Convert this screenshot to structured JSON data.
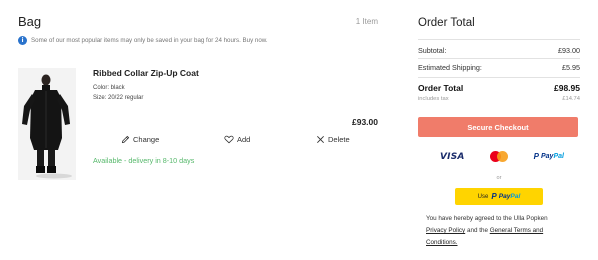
{
  "bag": {
    "title": "Bag",
    "item_count": "1 Item",
    "notice": "Some of our most popular items may only be saved in your bag for 24 hours. Buy now.",
    "notice_icon": "info-icon"
  },
  "product": {
    "name": "Ribbed Collar Zip-Up Coat",
    "color": "Color: black",
    "size": "Size: 20/22 regular",
    "price": "£93.00",
    "availability": "Available - delivery in 8-10 days",
    "actions": {
      "change": "Change",
      "add": "Add",
      "delete": "Delete"
    }
  },
  "summary": {
    "title": "Order Total",
    "subtotal_label": "Subtotal:",
    "subtotal_value": "£93.00",
    "shipping_label": "Estimated Shipping:",
    "shipping_value": "£5.95",
    "total_label": "Order Total",
    "total_value": "£98.95",
    "tax_label": "includes tax",
    "tax_value": "£14.74",
    "checkout_label": "Secure Checkout",
    "payment_methods": [
      "VISA",
      "Mastercard",
      "PayPal"
    ],
    "visa_label": "VISA",
    "paypal_pay": "Pay",
    "paypal_pal": "Pal",
    "or_label": "or",
    "paypal_button_prefix": "Use",
    "legal_text_1": "You have hereby agreed to the Ulla Popken",
    "privacy_link": "Privacy Policy",
    "legal_and": " and the ",
    "terms_link_1": "General Terms and",
    "terms_link_2": "Conditions."
  },
  "colors": {
    "checkout": "#f07c6a",
    "paypal_button": "#ffd400",
    "availability": "#56b86b",
    "info": "#2a73cc"
  }
}
